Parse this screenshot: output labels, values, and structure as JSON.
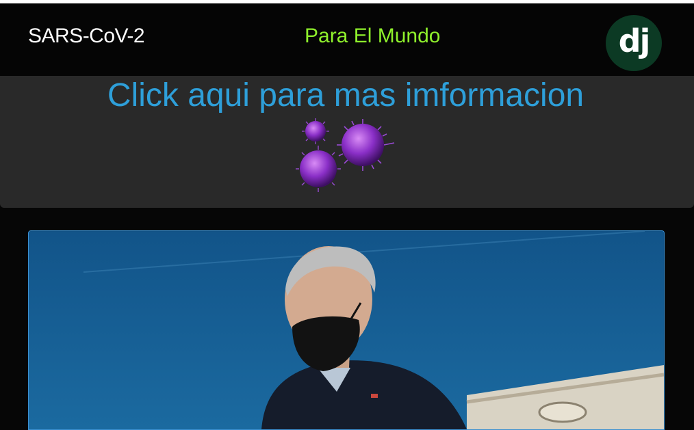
{
  "navbar": {
    "brand": "SARS-CoV-2",
    "center_link": "Para El Mundo",
    "logo_text": "dj",
    "logo_color": "#0c3a24",
    "center_color": "#8ff02c"
  },
  "jumbotron": {
    "link_text": "Click aqui para mas imformacion",
    "link_color": "#2e9fd9",
    "image_icon": "virus-icon"
  },
  "card": {
    "image_icon": "news-photo"
  }
}
